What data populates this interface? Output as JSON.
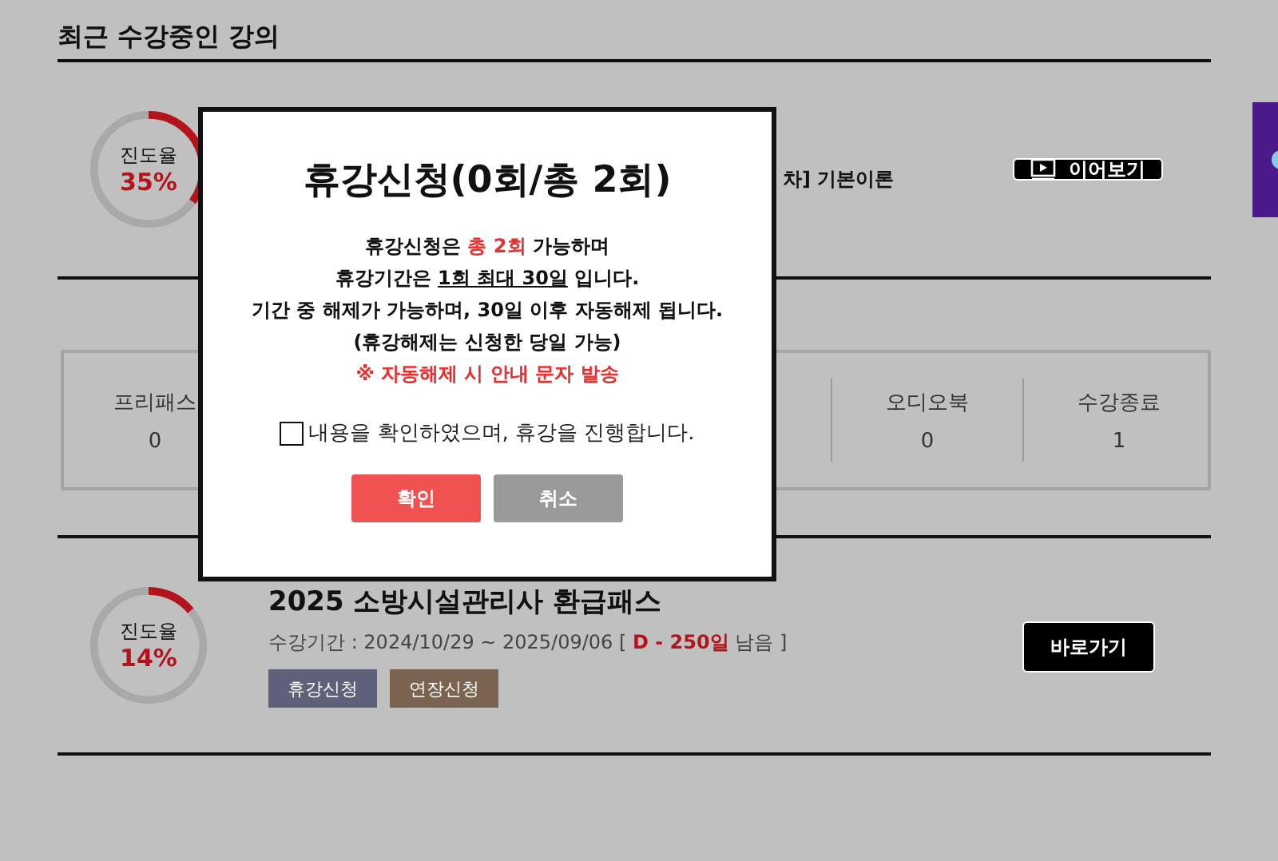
{
  "section_title": "최근 수강중인 강의",
  "courses": [
    {
      "kind": "partial",
      "progress_label": "진도율",
      "percent": "35%",
      "subtitle": "차] 기본이론",
      "button": {
        "label": "이어보기",
        "kind": "play"
      }
    },
    {
      "kind": "full",
      "progress_label": "진도율",
      "percent": "14%",
      "level": 0.14,
      "title": "2025 소방시설관리사 환급패스",
      "period": "수강기간 : 2024/10/29 ~ 2025/09/06 [ **D - 250일** 남음 ]",
      "tags": [
        {
          "label": "휴강신청",
          "color": "#5f6079"
        },
        {
          "label": "연장신청",
          "color": "#7b6352"
        }
      ],
      "button": {
        "label": "바로가기",
        "kind": "plain"
      }
    }
  ],
  "stats_leading": [
    {
      "label": "프리패스",
      "value": "0"
    }
  ],
  "stats_trailing": [
    {
      "label": "오디오북",
      "value": "0"
    },
    {
      "label": "수강종료",
      "value": "1"
    }
  ],
  "modal": {
    "title": "휴강신청(0회/총 2회)",
    "lines": [
      {
        "segments": [
          {
            "text": "휴강신청은 ",
            "kind": "plain"
          },
          {
            "text": "총 2회",
            "kind": "accent"
          },
          {
            "text": " 가능하며",
            "kind": "plain"
          }
        ]
      },
      {
        "segments": [
          {
            "text": "휴강기간은 ",
            "kind": "plain"
          },
          {
            "text": "1회 최대 30일",
            "kind": "underline"
          },
          {
            "text": " 입니다.",
            "kind": "plain"
          }
        ]
      },
      {
        "segments": [
          {
            "text": "기간 중 해제가 가능하며, 30일 이후 자동해제 됩니다.",
            "kind": "plain"
          }
        ]
      },
      {
        "segments": [
          {
            "text": "(휴강해제는 신청한 당일 가능)",
            "kind": "plain"
          }
        ]
      },
      {
        "segments": [
          {
            "text": "※ 자동해제 시 안내 문자 발송",
            "kind": "accent"
          }
        ]
      }
    ],
    "agree": {
      "label": "내용을 확인하였으며, 휴강을 진행합니다.",
      "checked": false
    },
    "buttons": [
      {
        "label": "확인",
        "kind": "primary"
      },
      {
        "label": "취소",
        "kind": "secondary"
      }
    ]
  }
}
